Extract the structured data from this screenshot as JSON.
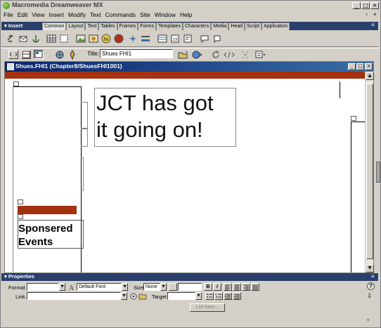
{
  "app": {
    "title": "Macromedia Dreamweaver MX",
    "win_min": "_",
    "win_max": "□",
    "win_close": "×"
  },
  "menu": [
    "File",
    "Edit",
    "View",
    "Insert",
    "Modify",
    "Text",
    "Commands",
    "Site",
    "Window",
    "Help"
  ],
  "insert_panel": {
    "title": "▾ Insert",
    "tabs": [
      "Common",
      "Layout",
      "Text",
      "Tables",
      "Frames",
      "Forms",
      "Templates",
      "Characters",
      "Media",
      "Head",
      "Script",
      "Application"
    ],
    "active_tab": "Common"
  },
  "doc_toolbar": {
    "title_label": "Title:",
    "title_value": "Shues FHI1"
  },
  "document": {
    "window_title": "Shues.FHI1 (Chapter8/ShuesFHI1001)",
    "headline_line1": "JCT has got",
    "headline_line2": "it going on!",
    "sponsor_line1": "Sponsered",
    "sponsor_line2": "Events"
  },
  "properties": {
    "title": "▾ Properties",
    "format_label": "Format",
    "format_value": "",
    "font_value": "Default Font",
    "size_label": "Size",
    "size_value": "None",
    "link_label": "Link",
    "link_value": "",
    "target_label": "Target",
    "target_value": "",
    "bold": "B",
    "italic": "I",
    "list_item_button": "List Item...",
    "help_icon": "?"
  },
  "colors": {
    "accent_red": "#a43110",
    "panel_header": "#2a3f6c",
    "doc_title_blue": "#0a246a"
  }
}
